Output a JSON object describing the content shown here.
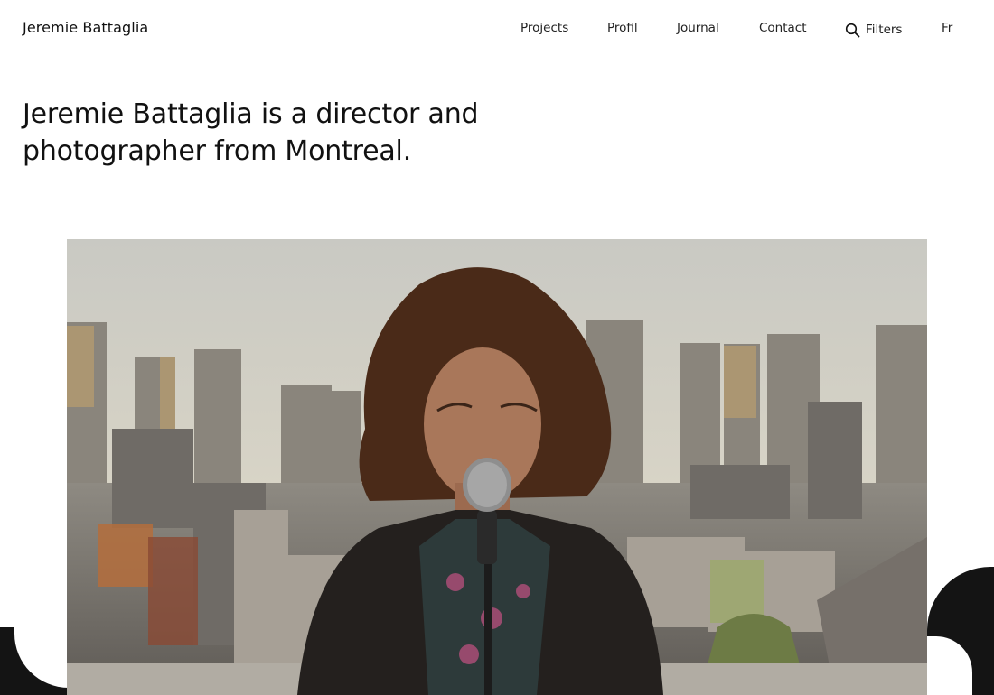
{
  "site": {
    "brand": "Jeremie Battaglia"
  },
  "nav": {
    "projects": "Projects",
    "profil": "Profil",
    "journal": "Journal",
    "contact": "Contact",
    "filters": "Filters",
    "language": "Fr"
  },
  "intro": {
    "text": "Jeremie Battaglia is a director and photographer from Montreal."
  },
  "icons": {
    "search": "search-icon"
  },
  "colors": {
    "text": "#111111",
    "background": "#ffffff",
    "decor": "#141414"
  }
}
